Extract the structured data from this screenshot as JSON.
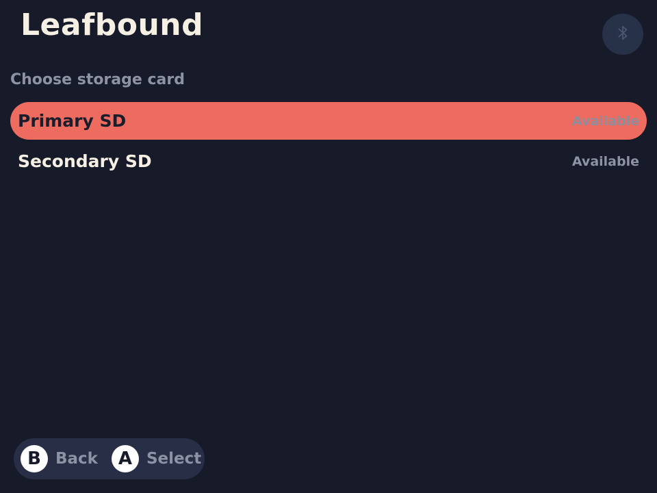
{
  "app": {
    "title": "Leafbound"
  },
  "header": {
    "bluetooth_icon": "bluetooth-icon"
  },
  "subtitle": "Choose storage card",
  "storage_list": {
    "items": [
      {
        "label": "Primary SD",
        "status": "Available",
        "selected": true
      },
      {
        "label": "Secondary SD",
        "status": "Available",
        "selected": false
      }
    ]
  },
  "footer": {
    "hints": [
      {
        "key": "B",
        "label": "Back"
      },
      {
        "key": "A",
        "label": "Select"
      }
    ]
  },
  "colors": {
    "background": "#171a28",
    "accent": "#ee6b60",
    "text_primary": "#f5efe4",
    "text_muted": "#8d93a5",
    "pill": "#272e45"
  }
}
